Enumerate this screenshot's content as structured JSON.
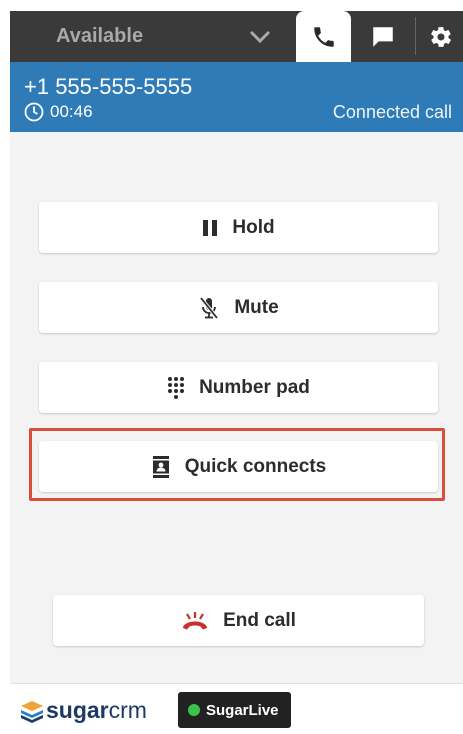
{
  "status": {
    "label": "Available"
  },
  "tabs": {
    "phone": "phone-icon",
    "chat": "chat-icon",
    "settings": "gear-icon"
  },
  "call": {
    "number": "+1 555-555-5555",
    "timer": "00:46",
    "state": "Connected call"
  },
  "actions": {
    "hold": "Hold",
    "mute": "Mute",
    "number_pad": "Number pad",
    "quick_connects": "Quick connects",
    "end_call": "End call"
  },
  "footer": {
    "logo_sugar": "sugar",
    "logo_crm": "crm",
    "badge": "SugarLive"
  },
  "colors": {
    "header": "#2f7bb8",
    "topbar": "#3a3a3a",
    "highlight": "#d94f3d",
    "end_call": "#c9302c",
    "online": "#3cc24b"
  }
}
